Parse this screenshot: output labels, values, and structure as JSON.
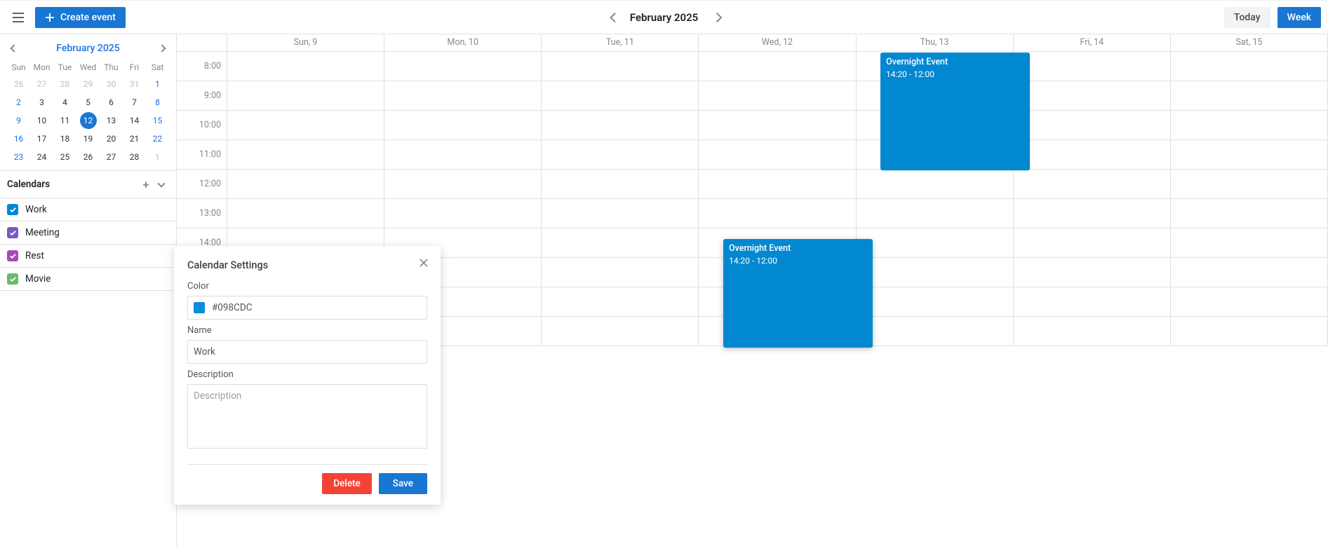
{
  "topbar": {
    "create_label": "Create event",
    "title": "February 2025",
    "today_label": "Today",
    "view_label": "Week"
  },
  "mini_cal": {
    "title": "February 2025",
    "dow": [
      "Sun",
      "Mon",
      "Tue",
      "Wed",
      "Thu",
      "Fri",
      "Sat"
    ],
    "weeks": [
      [
        {
          "n": "26",
          "out": true
        },
        {
          "n": "27",
          "out": true
        },
        {
          "n": "28",
          "out": true
        },
        {
          "n": "29",
          "out": true
        },
        {
          "n": "30",
          "out": true
        },
        {
          "n": "31",
          "out": true
        },
        {
          "n": "1",
          "sat": true
        }
      ],
      [
        {
          "n": "2",
          "sun": true
        },
        {
          "n": "3"
        },
        {
          "n": "4"
        },
        {
          "n": "5"
        },
        {
          "n": "6"
        },
        {
          "n": "7"
        },
        {
          "n": "8",
          "sat": true
        }
      ],
      [
        {
          "n": "9",
          "sun": true
        },
        {
          "n": "10"
        },
        {
          "n": "11"
        },
        {
          "n": "12",
          "selected": true
        },
        {
          "n": "13"
        },
        {
          "n": "14"
        },
        {
          "n": "15",
          "sat": true
        }
      ],
      [
        {
          "n": "16",
          "sun": true
        },
        {
          "n": "17"
        },
        {
          "n": "18"
        },
        {
          "n": "19"
        },
        {
          "n": "20"
        },
        {
          "n": "21"
        },
        {
          "n": "22",
          "sat": true
        }
      ],
      [
        {
          "n": "23",
          "sun": true
        },
        {
          "n": "24"
        },
        {
          "n": "25"
        },
        {
          "n": "26"
        },
        {
          "n": "27"
        },
        {
          "n": "28"
        },
        {
          "n": "1",
          "out": true
        }
      ]
    ]
  },
  "calendars": {
    "header": "Calendars",
    "items": [
      {
        "label": "Work",
        "color": "#0288d1"
      },
      {
        "label": "Meeting",
        "color": "#7e57c2"
      },
      {
        "label": "Rest",
        "color": "#ab47bc"
      },
      {
        "label": "Movie",
        "color": "#66bb6a"
      }
    ]
  },
  "week": {
    "days": [
      "Sun, 9",
      "Mon, 10",
      "Tue, 11",
      "Wed, 12",
      "Thu, 13",
      "Fri, 14",
      "Sat, 15"
    ],
    "hours": [
      "8:00",
      "9:00",
      "10:00",
      "11:00",
      "12:00",
      "13:00",
      "14:00"
    ]
  },
  "events": [
    {
      "title": "Overnight Event",
      "time": "14:20 - 12:00"
    },
    {
      "title": "Overnight Event",
      "time": "14:20 - 12:00"
    }
  ],
  "popup": {
    "title": "Calendar Settings",
    "color_label": "Color",
    "color_value": "#098CDC",
    "color_swatch": "#098cdc",
    "name_label": "Name",
    "name_value": "Work",
    "desc_label": "Description",
    "desc_placeholder": "Description",
    "delete": "Delete",
    "save": "Save"
  }
}
